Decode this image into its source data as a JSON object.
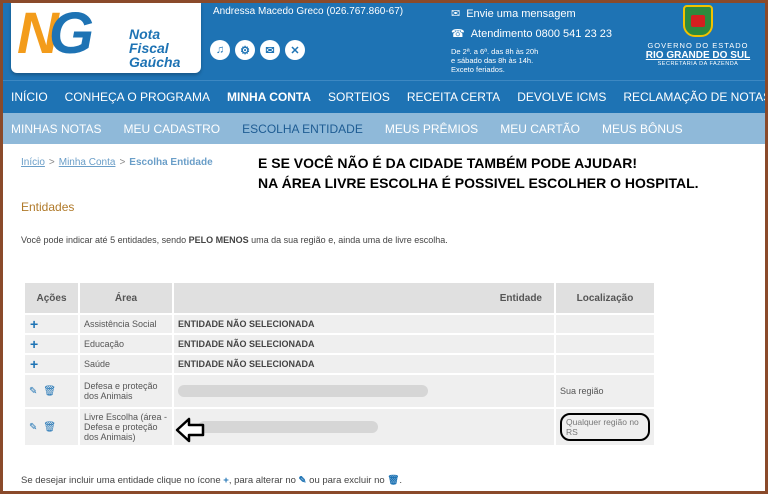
{
  "header": {
    "logo_mark_left": "N",
    "logo_mark_right": "G",
    "logo_line1": "Nota Fiscal",
    "logo_line2": "Gaúcha",
    "user": "Andressa Macedo Greco (026.767.860-67)",
    "icons": [
      "bell-icon",
      "gear-icon",
      "mail-icon",
      "close-icon"
    ],
    "contact_message": "Envie uma mensagem",
    "contact_phone": "Atendimento 0800 541 23 23",
    "hours_1": "De 2ª. a 6ª. das 8h às 20h",
    "hours_2": "e sábado das 8h às 14h.",
    "hours_3": "Exceto feriados.",
    "gov_line1": "GOVERNO DO ESTADO",
    "gov_line2": "RIO GRANDE DO SUL",
    "gov_line3": "SECRETARIA DA FAZENDA"
  },
  "menu1": [
    "INÍCIO",
    "CONHEÇA O PROGRAMA",
    "MINHA CONTA",
    "SORTEIOS",
    "RECEITA CERTA",
    "DEVOLVE ICMS",
    "RECLAMAÇÃO DE NOTAS FISCAIS"
  ],
  "menu2": [
    "MINHAS NOTAS",
    "MEU CADASTRO",
    "ESCOLHA ENTIDADE",
    "MEUS PRÊMIOS",
    "MEU CARTÃO",
    "MEUS BÔNUS"
  ],
  "breadcrumb": {
    "home": "Início",
    "sep1": ">",
    "account": "Minha Conta",
    "sep2": ">",
    "current": "Escolha Entidade"
  },
  "note_line1": "E SE VOCÊ NÃO É DA CIDADE TAMBÉM PODE AJUDAR!",
  "note_line2": "NA ÁREA LIVRE ESCOLHA É POSSIVEL ESCOLHER O HOSPITAL.",
  "section_title": "Entidades",
  "info_pre": "Você pode indicar até 5 entidades, sendo ",
  "info_bold": "PELO MENOS",
  "info_post": " uma da sua região e, ainda uma de livre escolha.",
  "table": {
    "headers": {
      "acoes": "Ações",
      "area": "Área",
      "entidade": "Entidade",
      "loc": "Localização"
    },
    "rows": [
      {
        "area": "Assistência Social",
        "entidade": "ENTIDADE NÃO SELECIONADA",
        "loc": ""
      },
      {
        "area": "Educação",
        "entidade": "ENTIDADE NÃO SELECIONADA",
        "loc": ""
      },
      {
        "area": "Saúde",
        "entidade": "ENTIDADE NÃO SELECIONADA",
        "loc": ""
      },
      {
        "area": "Defesa e proteção dos Animais",
        "entidade": "",
        "loc": "Sua região"
      },
      {
        "area": "Livre Escolha (área - Defesa e proteção dos Animais)",
        "entidade": "",
        "loc": "Qualquer região no RS"
      }
    ]
  },
  "footer": {
    "t1": "Se desejar incluir uma entidade clique no ícone ",
    "t2": ", para alterar no ",
    "t3": " ou para excluir no ",
    "t4": "."
  }
}
